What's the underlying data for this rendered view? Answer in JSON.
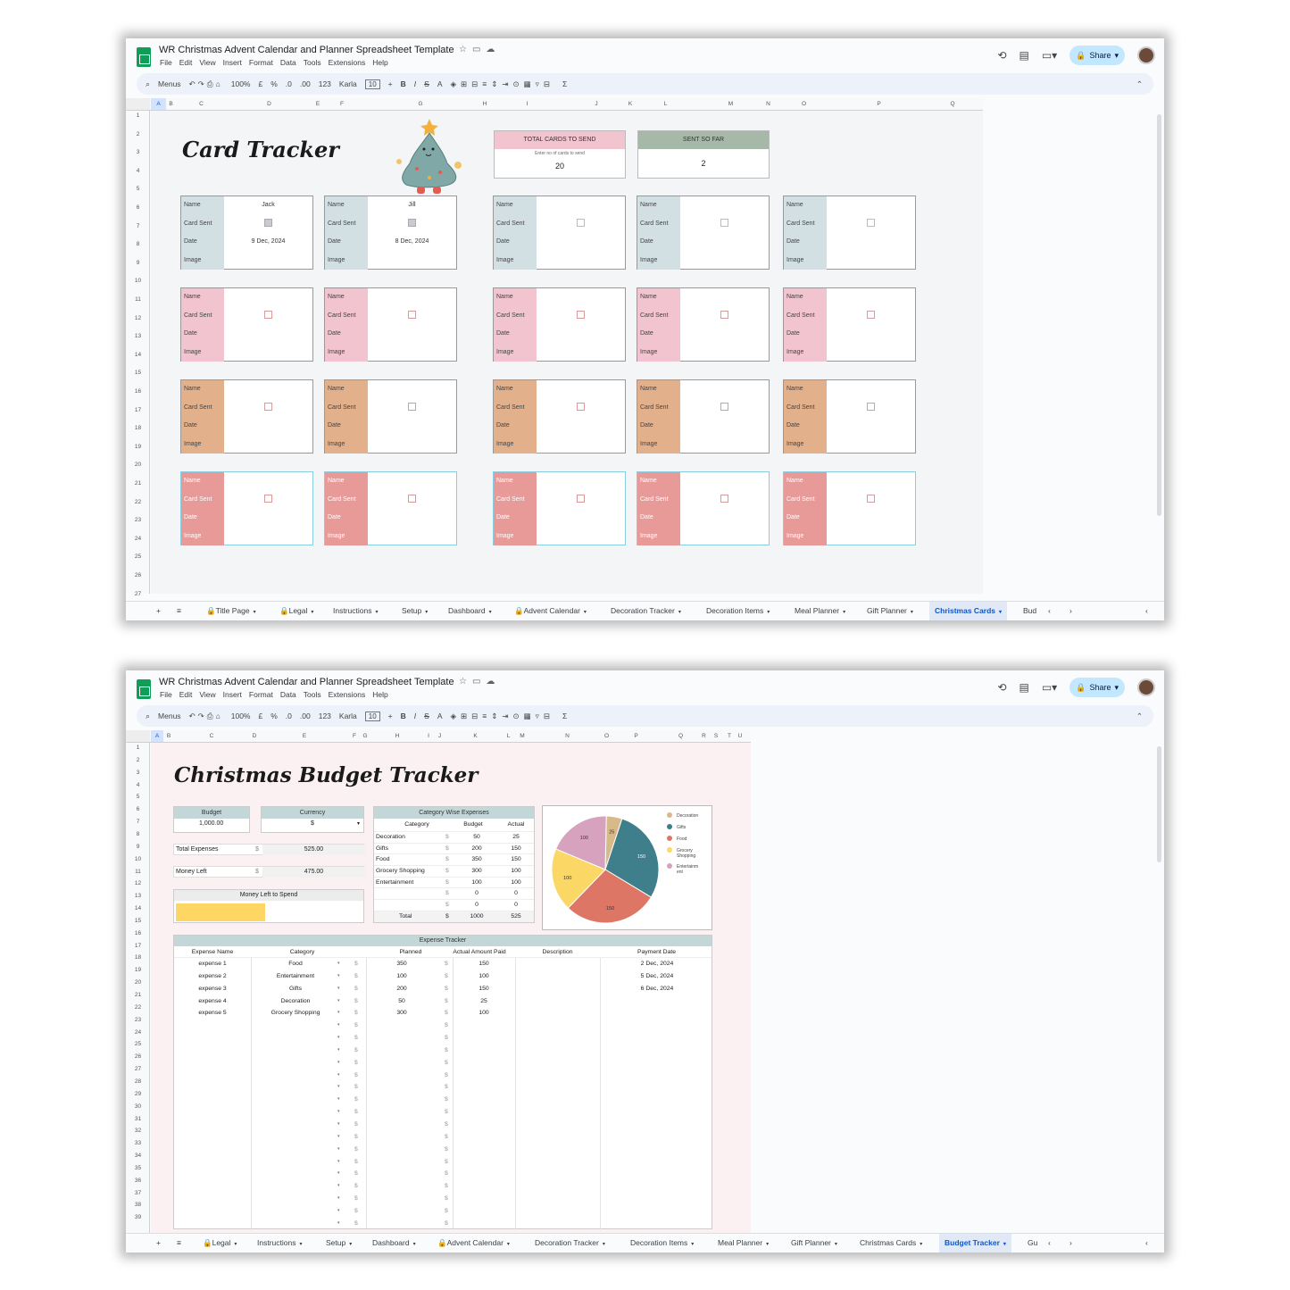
{
  "doc_title": "WR Christmas Advent Calendar and Planner Spreadsheet Template",
  "menu": [
    "File",
    "Edit",
    "View",
    "Insert",
    "Format",
    "Data",
    "Tools",
    "Extensions",
    "Help"
  ],
  "toolbar": {
    "search": "Menus",
    "zoom": "100%",
    "currency": "£",
    "percent": "%",
    "dec_down": ".0",
    "dec_up": ".00",
    "num_fmt": "123",
    "font": "Karla",
    "font_size": "10",
    "bold": "B",
    "italic": "I",
    "strike": "S",
    "text_color": "A",
    "sigma": "Σ"
  },
  "share_label": "Share",
  "sheet1": {
    "columns": [
      "A",
      "B",
      "C",
      "D",
      "E",
      "F",
      "G",
      "H",
      "I",
      "J",
      "K",
      "L",
      "M",
      "N",
      "O",
      "P",
      "Q"
    ],
    "rows": [
      "1",
      "2",
      "3",
      "4",
      "5",
      "6",
      "7",
      "8",
      "9",
      "10",
      "11",
      "12",
      "13",
      "14",
      "15",
      "16",
      "17",
      "18",
      "19",
      "20",
      "21",
      "22",
      "23",
      "24",
      "25",
      "26",
      "27"
    ],
    "title": "Card Tracker",
    "total_cards": {
      "label": "TOTAL CARDS TO SEND",
      "hint": "Enter no of cards to send",
      "value": "20"
    },
    "sent_so_far": {
      "label": "SENT SO FAR",
      "value": "2"
    },
    "field_labels": {
      "name": "Name",
      "sent": "Card Sent",
      "date": "Date",
      "image": "Image"
    },
    "card_rows": [
      {
        "color": "#d2e0e4",
        "cards": [
          {
            "name": "Jack",
            "sent": true,
            "date": "9 Dec, 2024"
          },
          {
            "name": "Jill",
            "sent": true,
            "date": "8 Dec, 2024"
          },
          {
            "name": "",
            "sent": false,
            "date": ""
          },
          {
            "name": "",
            "sent": false,
            "date": ""
          },
          {
            "name": "",
            "sent": false,
            "date": ""
          }
        ]
      },
      {
        "color": "#f1c4d0",
        "cards": [
          {
            "name": "",
            "sent": false,
            "date": ""
          },
          {
            "name": "",
            "sent": false,
            "date": ""
          },
          {
            "name": "",
            "sent": false,
            "date": ""
          },
          {
            "name": "",
            "sent": false,
            "date": ""
          },
          {
            "name": "",
            "sent": false,
            "date": ""
          }
        ]
      },
      {
        "color": "#e3b08c",
        "cards": [
          {
            "name": "",
            "sent": false,
            "date": ""
          },
          {
            "name": "",
            "sent": false,
            "date": ""
          },
          {
            "name": "",
            "sent": false,
            "date": ""
          },
          {
            "name": "",
            "sent": false,
            "date": ""
          },
          {
            "name": "",
            "sent": false,
            "date": ""
          }
        ]
      },
      {
        "color": "#e89a98",
        "cards": [
          {
            "name": "",
            "sent": false,
            "date": ""
          },
          {
            "name": "",
            "sent": false,
            "date": ""
          },
          {
            "name": "",
            "sent": false,
            "date": ""
          },
          {
            "name": "",
            "sent": false,
            "date": ""
          },
          {
            "name": "",
            "sent": false,
            "date": ""
          }
        ]
      }
    ],
    "tabs": [
      "Title Page",
      "Legal",
      "Instructions",
      "Setup",
      "Dashboard",
      "Advent Calendar",
      "Decoration Tracker",
      "Decoration Items",
      "Meal Planner",
      "Gift Planner",
      "Christmas Cards",
      "Bud"
    ],
    "active_tab": "Christmas Cards"
  },
  "sheet2": {
    "columns": [
      "A",
      "B",
      "C",
      "D",
      "E",
      "F",
      "G",
      "H",
      "I",
      "J",
      "K",
      "L",
      "M",
      "N",
      "O",
      "P",
      "Q",
      "R",
      "S",
      "T",
      "U"
    ],
    "rows": [
      "1",
      "2",
      "3",
      "4",
      "5",
      "6",
      "7",
      "8",
      "9",
      "10",
      "11",
      "12",
      "13",
      "14",
      "15",
      "16",
      "17",
      "18",
      "19",
      "20",
      "21",
      "22",
      "23",
      "24",
      "25",
      "26",
      "27",
      "28",
      "29",
      "30",
      "31",
      "32",
      "33",
      "34",
      "35",
      "36",
      "37",
      "38",
      "39"
    ],
    "title": "Christmas Budget Tracker",
    "budget_label": "Budget",
    "budget_value": "1,000.00",
    "currency_label": "Currency",
    "currency_value": "$",
    "total_expenses_label": "Total Expenses",
    "total_expenses_value": "525.00",
    "money_left_label": "Money Left",
    "money_left_value": "475.00",
    "money_left_spend_label": "Money Left to Spend",
    "money_left_fraction": 0.475,
    "dollar": "$",
    "cat_table": {
      "title": "Category Wise Expenses",
      "headers": [
        "Category",
        "Budget",
        "Actual"
      ],
      "rows": [
        [
          "Decoration",
          "50",
          "25"
        ],
        [
          "Gifts",
          "200",
          "150"
        ],
        [
          "Food",
          "350",
          "150"
        ],
        [
          "Grocery Shopping",
          "300",
          "100"
        ],
        [
          "Entertainment",
          "100",
          "100"
        ],
        [
          "",
          "0",
          "0"
        ],
        [
          "",
          "0",
          "0"
        ]
      ],
      "total": [
        "Total",
        "1000",
        "525"
      ]
    },
    "chart_data": {
      "type": "pie",
      "categories": [
        "Decoration",
        "Gifts",
        "Food",
        "Grocery Shopping",
        "Entertainment"
      ],
      "legend_labels": [
        "Decoration",
        "Gifts",
        "Food",
        "Grocery\nShopping",
        "Entertainm\nent"
      ],
      "values": [
        25,
        150,
        150,
        100,
        100
      ],
      "colors": [
        "#d7b98a",
        "#3f7f8c",
        "#dd7665",
        "#fbd766",
        "#d7a2be"
      ],
      "legend": "right"
    },
    "expense_tracker": {
      "title": "Expense Tracker",
      "headers": [
        "Expense Name",
        "Category",
        "Planned",
        "Actual Amount Paid",
        "Description",
        "Payment Date"
      ],
      "rows": [
        [
          "expense 1",
          "Food",
          "350",
          "150",
          "",
          "2 Dec, 2024"
        ],
        [
          "expense 2",
          "Entertainment",
          "100",
          "100",
          "",
          "5 Dec, 2024"
        ],
        [
          "expense 3",
          "Gifts",
          "200",
          "150",
          "",
          "6 Dec, 2024"
        ],
        [
          "expense 4",
          "Decoration",
          "50",
          "25",
          "",
          ""
        ],
        [
          "expense 5",
          "Grocery Shopping",
          "300",
          "100",
          "",
          ""
        ]
      ]
    },
    "tabs": [
      "Legal",
      "Instructions",
      "Setup",
      "Dashboard",
      "Advent Calendar",
      "Decoration Tracker",
      "Decoration Items",
      "Meal Planner",
      "Gift Planner",
      "Christmas Cards",
      "Budget Tracker",
      "Gu"
    ],
    "active_tab": "Budget Tracker"
  }
}
